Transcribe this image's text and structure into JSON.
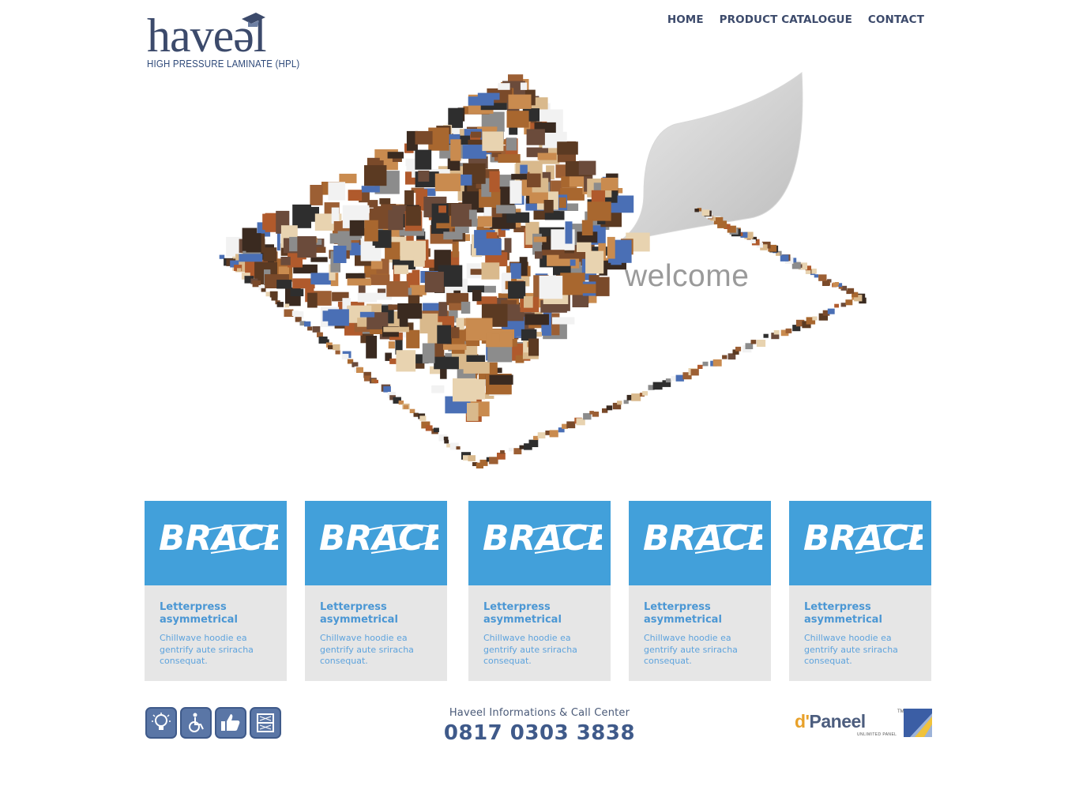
{
  "header": {
    "logo_word": "have",
    "logo_sub": "HIGH PRESSURE LAMINATE (HPL)",
    "nav": [
      {
        "label": "HOME"
      },
      {
        "label": "PRODUCT CATALOGUE"
      },
      {
        "label": "CONTACT"
      }
    ]
  },
  "hero": {
    "welcome": "welcome"
  },
  "cards": [
    {
      "image_text": "BRACE",
      "title": "Letterpress asymmetrical",
      "text": "Chillwave hoodie ea gentrify aute sriracha consequat."
    },
    {
      "image_text": "BRACE",
      "title": "Letterpress asymmetrical",
      "text": "Chillwave hoodie ea gentrify aute sriracha consequat."
    },
    {
      "image_text": "BRACE",
      "title": "Letterpress asymmetrical",
      "text": "Chillwave hoodie ea gentrify aute sriracha consequat."
    },
    {
      "image_text": "BRACE",
      "title": "Letterpress asymmetrical",
      "text": "Chillwave hoodie ea gentrify aute sriracha consequat."
    },
    {
      "image_text": "BRACE",
      "title": "Letterpress asymmetrical",
      "text": "Chillwave hoodie ea gentrify aute sriracha consequat."
    }
  ],
  "footer": {
    "feature_icons": [
      "lightbulb-icon",
      "wheelchair-icon",
      "thumbs-up-icon",
      "cabinet-icon"
    ],
    "callcenter_label": "Haveel Informations & Call Center",
    "callcenter_phone": "0817 0303 3838",
    "partner_logo": {
      "prefix": "d'",
      "name": "Paneel",
      "tm": "TM",
      "sub": "UNLIMITED PANEL"
    }
  },
  "colors": {
    "brand_navy": "#3c4a6b",
    "card_blue": "#42a0da",
    "card_bg": "#e6e6e6",
    "card_text": "#5ea3dd",
    "icon_bg": "#5a76a6",
    "partner_accent": "#e8a12a"
  }
}
